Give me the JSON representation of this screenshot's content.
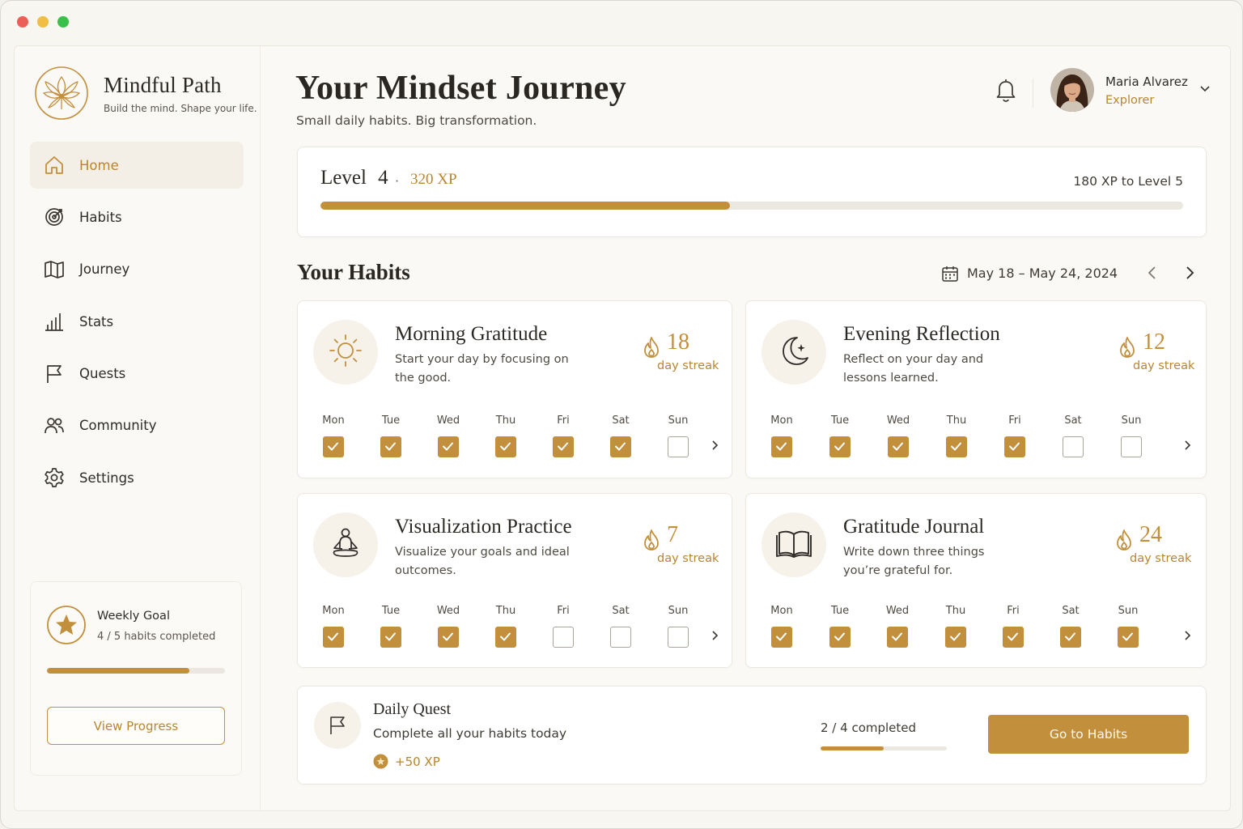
{
  "brand": {
    "name": "Mindful Path",
    "tagline": "Build the mind. Shape your life."
  },
  "nav": [
    {
      "label": "Home",
      "icon": "home-icon",
      "active": true
    },
    {
      "label": "Habits",
      "icon": "target-icon"
    },
    {
      "label": "Journey",
      "icon": "map-icon"
    },
    {
      "label": "Stats",
      "icon": "bar-chart-icon"
    },
    {
      "label": "Quests",
      "icon": "flag-icon"
    },
    {
      "label": "Community",
      "icon": "users-icon"
    },
    {
      "label": "Settings",
      "icon": "gear-icon"
    }
  ],
  "weekly_goal": {
    "title": "Weekly Goal",
    "summary": "4 / 5 habits completed",
    "progress": 0.8,
    "button": "View Progress"
  },
  "header": {
    "title": "Your Mindset Journey",
    "subtitle": "Small daily habits. Big transformation.",
    "user": {
      "name": "Maria Alvarez",
      "role": "Explorer"
    }
  },
  "level": {
    "label": "Level",
    "number": "4",
    "separator": "·",
    "xp": "320 XP",
    "to_next": "180 XP to Level 5",
    "progress": 0.475
  },
  "habits_section": {
    "title": "Your Habits",
    "date_range": "May 18 – May 24, 2024"
  },
  "days": [
    "Mon",
    "Tue",
    "Wed",
    "Thu",
    "Fri",
    "Sat",
    "Sun"
  ],
  "habits": [
    {
      "title": "Morning Gratitude",
      "desc": "Start your day by focusing on the good.",
      "streak": "18",
      "streak_label": "day streak",
      "icon": "sun-icon",
      "checks": [
        true,
        true,
        true,
        true,
        true,
        true,
        false
      ]
    },
    {
      "title": "Evening Reflection",
      "desc": "Reflect on your day and lessons learned.",
      "streak": "12",
      "streak_label": "day streak",
      "icon": "moon-icon",
      "checks": [
        true,
        true,
        true,
        true,
        true,
        false,
        false
      ]
    },
    {
      "title": "Visualization Practice",
      "desc": "Visualize your goals and ideal outcomes.",
      "streak": "7",
      "streak_label": "day streak",
      "icon": "meditation-icon",
      "checks": [
        true,
        true,
        true,
        true,
        false,
        false,
        false
      ]
    },
    {
      "title": "Gratitude Journal",
      "desc": "Write down three things you’re grateful for.",
      "streak": "24",
      "streak_label": "day streak",
      "icon": "book-icon",
      "checks": [
        true,
        true,
        true,
        true,
        true,
        true,
        true
      ]
    }
  ],
  "quest": {
    "title": "Daily Quest",
    "desc": "Complete all your habits today",
    "reward": "+50 XP",
    "progress_text": "2 / 4 completed",
    "progress": 0.5,
    "button": "Go to Habits"
  },
  "colors": {
    "accent": "#c28f3c",
    "background": "#faf9f6",
    "text": "#2f2c28"
  }
}
